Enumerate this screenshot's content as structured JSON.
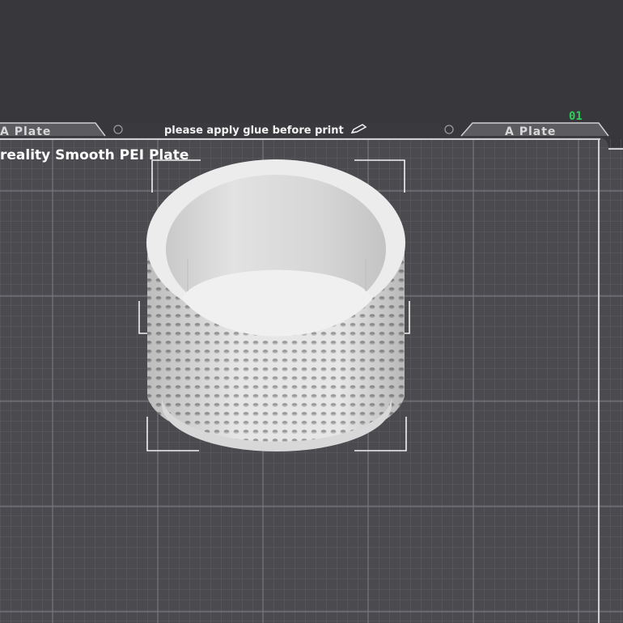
{
  "viewport": {
    "plate_tab_left": "A Plate",
    "plate_tab_right": "A Plate",
    "plate_notice": "please apply glue before print",
    "plate_type": "reality Smooth PEI Plate",
    "plate_number": "01"
  },
  "icons": {
    "edit_notice": "pencil-icon"
  },
  "colors": {
    "background": "#38383c",
    "plate_surface": "#4b4b50",
    "grid_line": "#6a6a70",
    "model": "#e8e8e8",
    "plate_number": "#2ecc5a"
  }
}
